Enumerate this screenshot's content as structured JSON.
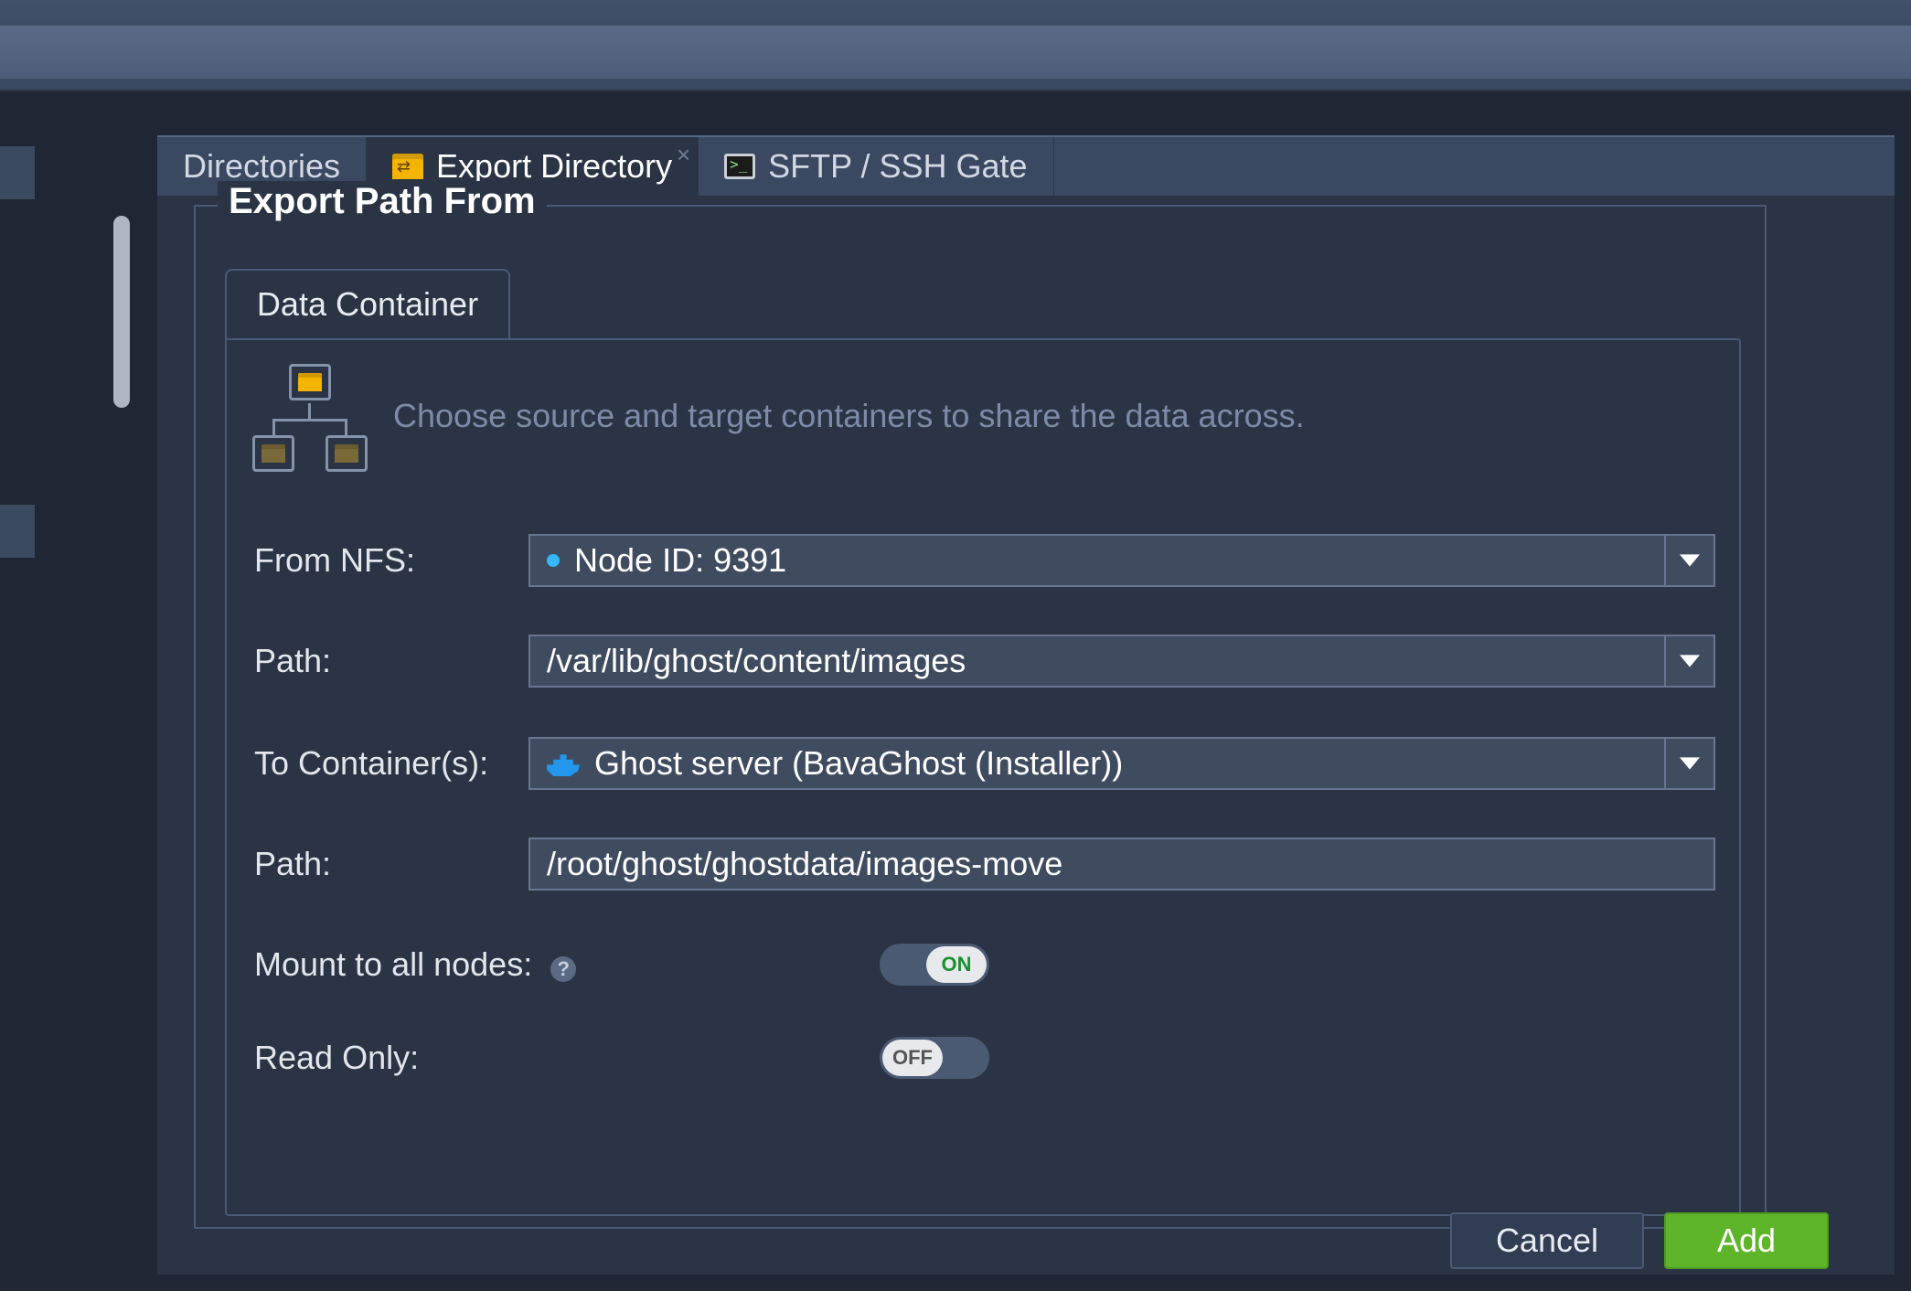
{
  "tabs": {
    "directories": "Directories",
    "export": "Export Directory",
    "sftp": "SFTP / SSH Gate"
  },
  "fieldset_title": "Export Path From",
  "inner_tab": "Data Container",
  "hint": "Choose source and target containers to share the data across.",
  "labels": {
    "from_nfs": "From NFS:",
    "path": "Path:",
    "to_cont": "To Container(s):",
    "mount_all": "Mount to all nodes:",
    "read_only": "Read Only:"
  },
  "values": {
    "from_nfs": "Node ID: 9391",
    "src_path": "/var/lib/ghost/content/images",
    "to_cont": "Ghost server (BavaGhost (Installer))",
    "dst_path": "/root/ghost/ghostdata/images-move"
  },
  "toggles": {
    "mount_all": "ON",
    "read_only": "OFF"
  },
  "buttons": {
    "cancel": "Cancel",
    "add": "Add"
  }
}
